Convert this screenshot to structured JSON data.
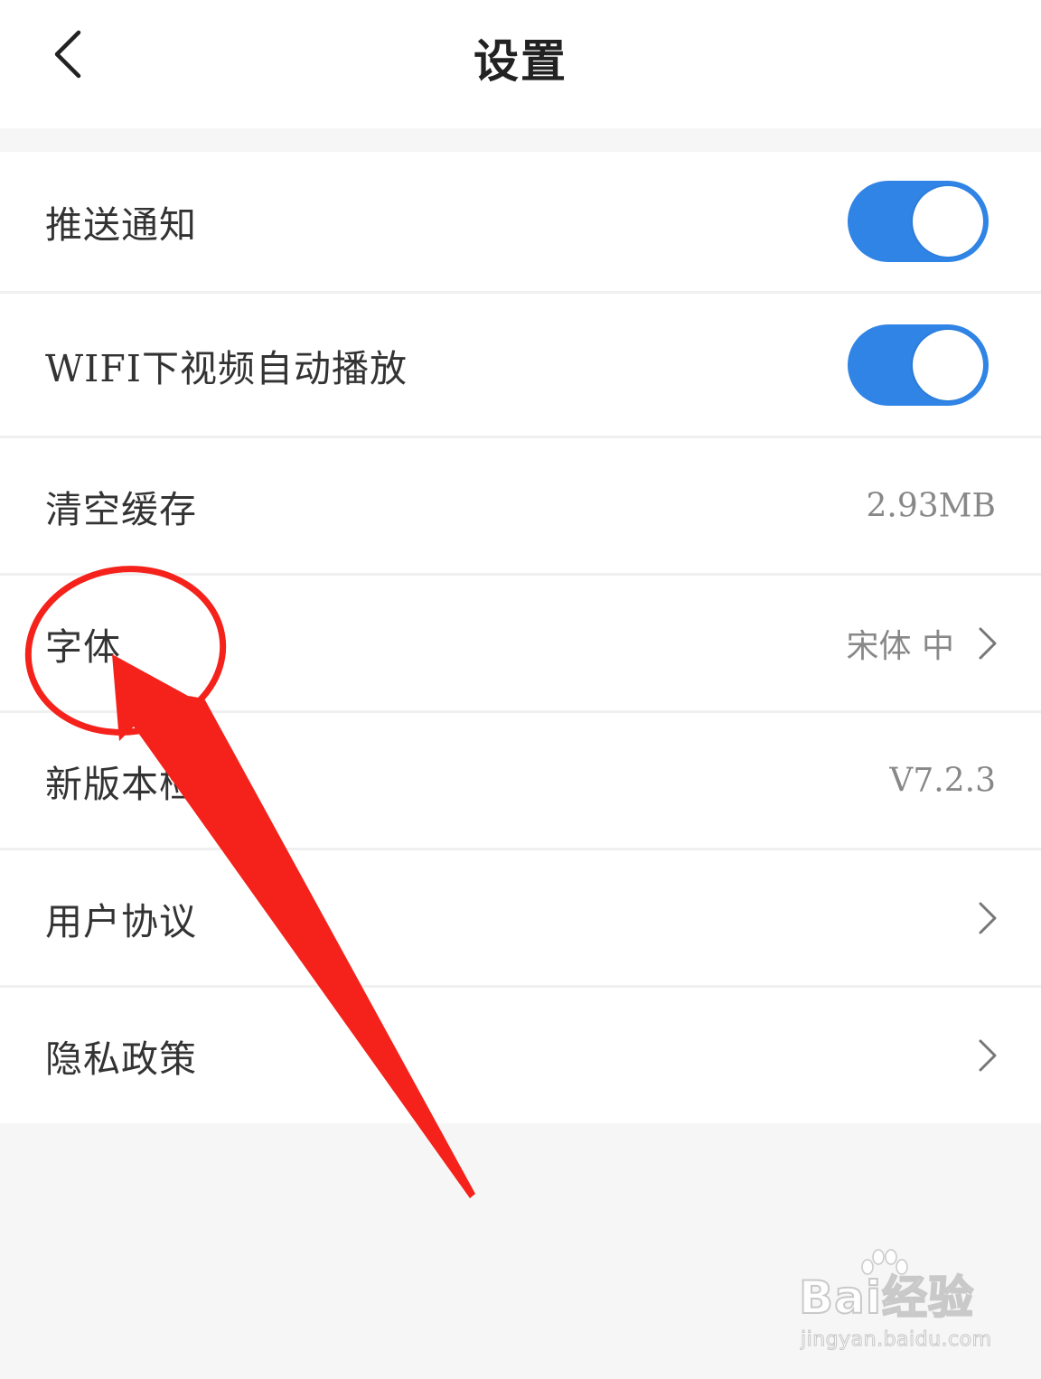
{
  "header": {
    "title": "设置",
    "back_icon": "chevron-left-icon"
  },
  "settings": {
    "push_notification": {
      "label": "推送通知",
      "enabled": true
    },
    "wifi_autoplay": {
      "label": "WIFI下视频自动播放",
      "enabled": true
    },
    "clear_cache": {
      "label": "清空缓存",
      "value": "2.93MB"
    },
    "font": {
      "label": "字体",
      "value": "宋体 中"
    },
    "version_check": {
      "label": "新版本检测",
      "value": "V7.2.3"
    },
    "user_agreement": {
      "label": "用户协议"
    },
    "privacy_policy": {
      "label": "隐私政策"
    }
  },
  "colors": {
    "toggle_on": "#2f84e6",
    "annotation_red": "#f5221b",
    "background": "#f6f6f6"
  },
  "watermark": {
    "brand": "Bai经验",
    "url": "jingyan.baidu.com"
  }
}
